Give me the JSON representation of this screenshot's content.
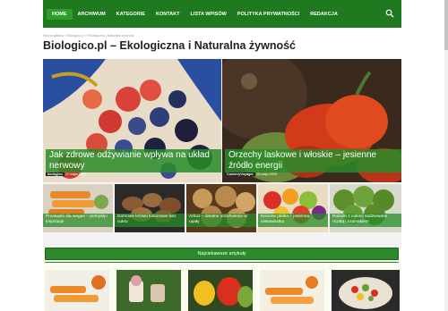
{
  "nav": {
    "items": [
      "HOME",
      "ARCHIWUM",
      "KATEGORIE",
      "KONTAKT",
      "LISTA WPISÓW",
      "POLITYKA PRYWATNOŚCI",
      "REDAKCJA"
    ],
    "icon": "search-icon"
  },
  "breadcrumb": "Strona główna > Biologico.pl > Ekologiczna i Naturalna żywność",
  "page_title": "Biologico.pl – Ekologiczna i Naturalna żywność",
  "featured": [
    {
      "title": "Jak zdrowe odżywianie wpływa na układ nerwowy",
      "author": "biologico",
      "date": "17 maja 2025"
    },
    {
      "title": "Orzechy laskowe i włoskie – jesienne źródło energii",
      "author": "CookeryVoyager",
      "date": "15 maja 2025"
    }
  ],
  "small_cards": [
    {
      "title": "Przekąski dla wegan – pomysły i inspiracje"
    },
    {
      "title": "Domowe krówki kokosowe bez cukru"
    },
    {
      "title": "Arbuz – idealne orzeźwienie w upały"
    },
    {
      "title": "Kiszone jabłka – jesienna ciekawostka"
    },
    {
      "title": "Roladki z cukinii nadziewane ricottą i szpinakiem"
    }
  ],
  "recent": {
    "header": "Najciekawsze artykuły"
  },
  "colors": {
    "nav": "#1f7a1f",
    "accent": "#2c8a2c"
  }
}
